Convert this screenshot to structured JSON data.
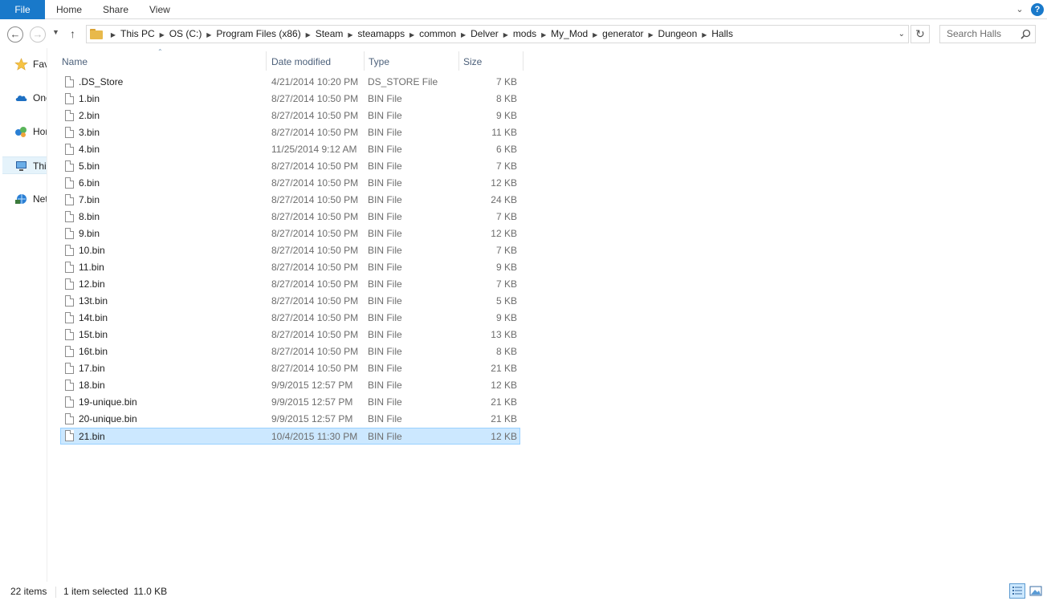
{
  "ribbon": {
    "tabs": [
      "File",
      "Home",
      "Share",
      "View"
    ],
    "help": "?"
  },
  "nav": {
    "recent_arrow": "▼",
    "breadcrumbs": [
      "This PC",
      "OS (C:)",
      "Program Files (x86)",
      "Steam",
      "steamapps",
      "common",
      "Delver",
      "mods",
      "My_Mod",
      "generator",
      "Dungeon",
      "Halls"
    ],
    "search_placeholder": "Search Halls"
  },
  "navpane": {
    "items": [
      {
        "label": "Favorites",
        "icon": "star-icon"
      },
      {
        "label": "OneDrive",
        "icon": "cloud-icon"
      },
      {
        "label": "Homegroup",
        "icon": "homegroup-icon"
      },
      {
        "label": "This PC",
        "icon": "computer-icon"
      },
      {
        "label": "Network",
        "icon": "network-icon"
      }
    ]
  },
  "columns": {
    "name": "Name",
    "date": "Date modified",
    "type": "Type",
    "size": "Size"
  },
  "files": [
    {
      "name": ".DS_Store",
      "date": "4/21/2014 10:20 PM",
      "type": "DS_STORE File",
      "size": "7 KB"
    },
    {
      "name": "1.bin",
      "date": "8/27/2014 10:50 PM",
      "type": "BIN File",
      "size": "8 KB"
    },
    {
      "name": "2.bin",
      "date": "8/27/2014 10:50 PM",
      "type": "BIN File",
      "size": "9 KB"
    },
    {
      "name": "3.bin",
      "date": "8/27/2014 10:50 PM",
      "type": "BIN File",
      "size": "11 KB"
    },
    {
      "name": "4.bin",
      "date": "11/25/2014 9:12 AM",
      "type": "BIN File",
      "size": "6 KB"
    },
    {
      "name": "5.bin",
      "date": "8/27/2014 10:50 PM",
      "type": "BIN File",
      "size": "7 KB"
    },
    {
      "name": "6.bin",
      "date": "8/27/2014 10:50 PM",
      "type": "BIN File",
      "size": "12 KB"
    },
    {
      "name": "7.bin",
      "date": "8/27/2014 10:50 PM",
      "type": "BIN File",
      "size": "24 KB"
    },
    {
      "name": "8.bin",
      "date": "8/27/2014 10:50 PM",
      "type": "BIN File",
      "size": "7 KB"
    },
    {
      "name": "9.bin",
      "date": "8/27/2014 10:50 PM",
      "type": "BIN File",
      "size": "12 KB"
    },
    {
      "name": "10.bin",
      "date": "8/27/2014 10:50 PM",
      "type": "BIN File",
      "size": "7 KB"
    },
    {
      "name": "11.bin",
      "date": "8/27/2014 10:50 PM",
      "type": "BIN File",
      "size": "9 KB"
    },
    {
      "name": "12.bin",
      "date": "8/27/2014 10:50 PM",
      "type": "BIN File",
      "size": "7 KB"
    },
    {
      "name": "13t.bin",
      "date": "8/27/2014 10:50 PM",
      "type": "BIN File",
      "size": "5 KB"
    },
    {
      "name": "14t.bin",
      "date": "8/27/2014 10:50 PM",
      "type": "BIN File",
      "size": "9 KB"
    },
    {
      "name": "15t.bin",
      "date": "8/27/2014 10:50 PM",
      "type": "BIN File",
      "size": "13 KB"
    },
    {
      "name": "16t.bin",
      "date": "8/27/2014 10:50 PM",
      "type": "BIN File",
      "size": "8 KB"
    },
    {
      "name": "17.bin",
      "date": "8/27/2014 10:50 PM",
      "type": "BIN File",
      "size": "21 KB"
    },
    {
      "name": "18.bin",
      "date": "9/9/2015 12:57 PM",
      "type": "BIN File",
      "size": "12 KB"
    },
    {
      "name": "19-unique.bin",
      "date": "9/9/2015 12:57 PM",
      "type": "BIN File",
      "size": "21 KB"
    },
    {
      "name": "20-unique.bin",
      "date": "9/9/2015 12:57 PM",
      "type": "BIN File",
      "size": "21 KB"
    },
    {
      "name": "21.bin",
      "date": "10/4/2015 11:30 PM",
      "type": "BIN File",
      "size": "12 KB",
      "selected": true
    }
  ],
  "status": {
    "item_count": "22 items",
    "selection": "1 item selected  11.0 KB"
  },
  "colors": {
    "accent": "#1979ca",
    "selection_fill": "#cce8ff",
    "selection_border": "#99d1ff",
    "header_text": "#4c607a"
  }
}
